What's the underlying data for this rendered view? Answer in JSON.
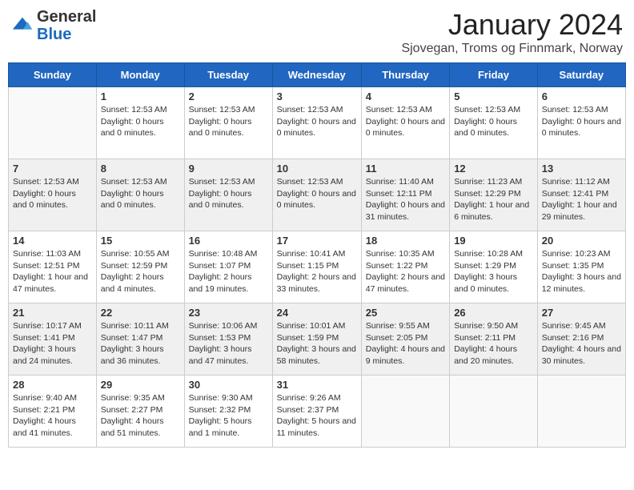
{
  "header": {
    "logo_general": "General",
    "logo_blue": "Blue",
    "month": "January 2024",
    "location": "Sjovegan, Troms og Finnmark, Norway"
  },
  "days_of_week": [
    "Sunday",
    "Monday",
    "Tuesday",
    "Wednesday",
    "Thursday",
    "Friday",
    "Saturday"
  ],
  "weeks": [
    {
      "shaded": false,
      "days": [
        {
          "number": "",
          "info": ""
        },
        {
          "number": "1",
          "info": "Sunset: 12:53 AM\nDaylight: 0 hours and 0 minutes."
        },
        {
          "number": "2",
          "info": "Sunset: 12:53 AM\nDaylight: 0 hours and 0 minutes."
        },
        {
          "number": "3",
          "info": "Sunset: 12:53 AM\nDaylight: 0 hours and 0 minutes."
        },
        {
          "number": "4",
          "info": "Sunset: 12:53 AM\nDaylight: 0 hours and 0 minutes."
        },
        {
          "number": "5",
          "info": "Sunset: 12:53 AM\nDaylight: 0 hours and 0 minutes."
        },
        {
          "number": "6",
          "info": "Sunset: 12:53 AM\nDaylight: 0 hours and 0 minutes."
        }
      ]
    },
    {
      "shaded": true,
      "days": [
        {
          "number": "7",
          "info": "Sunset: 12:53 AM\nDaylight: 0 hours and 0 minutes."
        },
        {
          "number": "8",
          "info": "Sunset: 12:53 AM\nDaylight: 0 hours and 0 minutes."
        },
        {
          "number": "9",
          "info": "Sunset: 12:53 AM\nDaylight: 0 hours and 0 minutes."
        },
        {
          "number": "10",
          "info": "Sunset: 12:53 AM\nDaylight: 0 hours and 0 minutes."
        },
        {
          "number": "11",
          "info": "Sunrise: 11:40 AM\nSunset: 12:11 PM\nDaylight: 0 hours and 31 minutes."
        },
        {
          "number": "12",
          "info": "Sunrise: 11:23 AM\nSunset: 12:29 PM\nDaylight: 1 hour and 6 minutes."
        },
        {
          "number": "13",
          "info": "Sunrise: 11:12 AM\nSunset: 12:41 PM\nDaylight: 1 hour and 29 minutes."
        }
      ]
    },
    {
      "shaded": false,
      "days": [
        {
          "number": "14",
          "info": "Sunrise: 11:03 AM\nSunset: 12:51 PM\nDaylight: 1 hour and 47 minutes."
        },
        {
          "number": "15",
          "info": "Sunrise: 10:55 AM\nSunset: 12:59 PM\nDaylight: 2 hours and 4 minutes."
        },
        {
          "number": "16",
          "info": "Sunrise: 10:48 AM\nSunset: 1:07 PM\nDaylight: 2 hours and 19 minutes."
        },
        {
          "number": "17",
          "info": "Sunrise: 10:41 AM\nSunset: 1:15 PM\nDaylight: 2 hours and 33 minutes."
        },
        {
          "number": "18",
          "info": "Sunrise: 10:35 AM\nSunset: 1:22 PM\nDaylight: 2 hours and 47 minutes."
        },
        {
          "number": "19",
          "info": "Sunrise: 10:28 AM\nSunset: 1:29 PM\nDaylight: 3 hours and 0 minutes."
        },
        {
          "number": "20",
          "info": "Sunrise: 10:23 AM\nSunset: 1:35 PM\nDaylight: 3 hours and 12 minutes."
        }
      ]
    },
    {
      "shaded": true,
      "days": [
        {
          "number": "21",
          "info": "Sunrise: 10:17 AM\nSunset: 1:41 PM\nDaylight: 3 hours and 24 minutes."
        },
        {
          "number": "22",
          "info": "Sunrise: 10:11 AM\nSunset: 1:47 PM\nDaylight: 3 hours and 36 minutes."
        },
        {
          "number": "23",
          "info": "Sunrise: 10:06 AM\nSunset: 1:53 PM\nDaylight: 3 hours and 47 minutes."
        },
        {
          "number": "24",
          "info": "Sunrise: 10:01 AM\nSunset: 1:59 PM\nDaylight: 3 hours and 58 minutes."
        },
        {
          "number": "25",
          "info": "Sunrise: 9:55 AM\nSunset: 2:05 PM\nDaylight: 4 hours and 9 minutes."
        },
        {
          "number": "26",
          "info": "Sunrise: 9:50 AM\nSunset: 2:11 PM\nDaylight: 4 hours and 20 minutes."
        },
        {
          "number": "27",
          "info": "Sunrise: 9:45 AM\nSunset: 2:16 PM\nDaylight: 4 hours and 30 minutes."
        }
      ]
    },
    {
      "shaded": false,
      "days": [
        {
          "number": "28",
          "info": "Sunrise: 9:40 AM\nSunset: 2:21 PM\nDaylight: 4 hours and 41 minutes."
        },
        {
          "number": "29",
          "info": "Sunrise: 9:35 AM\nSunset: 2:27 PM\nDaylight: 4 hours and 51 minutes."
        },
        {
          "number": "30",
          "info": "Sunrise: 9:30 AM\nSunset: 2:32 PM\nDaylight: 5 hours and 1 minute."
        },
        {
          "number": "31",
          "info": "Sunrise: 9:26 AM\nSunset: 2:37 PM\nDaylight: 5 hours and 11 minutes."
        },
        {
          "number": "",
          "info": ""
        },
        {
          "number": "",
          "info": ""
        },
        {
          "number": "",
          "info": ""
        }
      ]
    }
  ]
}
